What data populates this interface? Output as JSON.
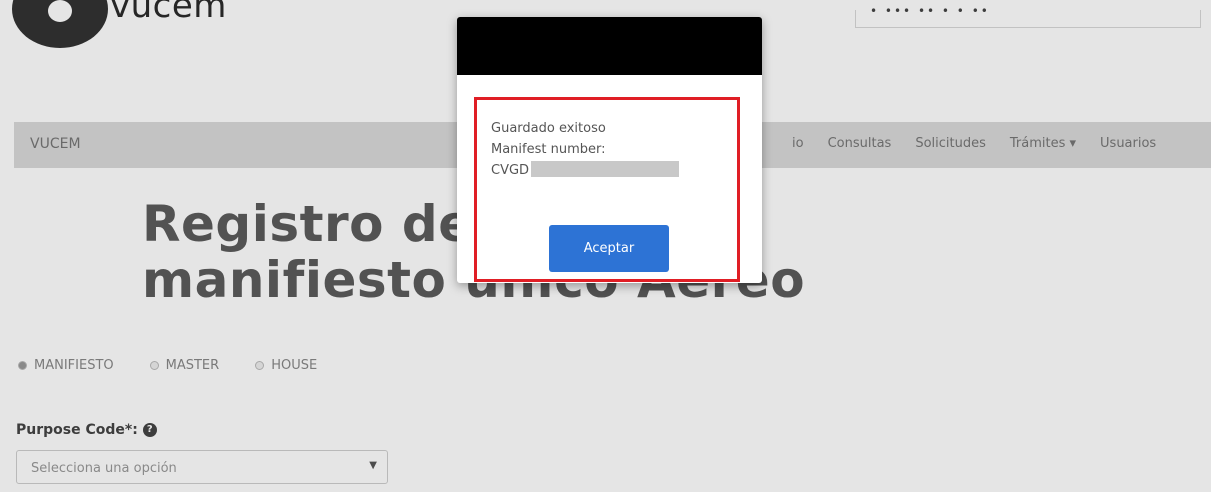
{
  "header": {
    "logo_text": "vucem",
    "top_right_text": "• ••• •• • • ••"
  },
  "navbar": {
    "brand": "VUCEM",
    "items": [
      "io",
      "Consultas",
      "Solicitudes",
      "Trámites ▾",
      "Usuarios"
    ]
  },
  "main": {
    "title_line1": "Registro de",
    "title_line2": "manifiesto único Aéreo",
    "radio_options": [
      {
        "label": "MANIFIESTO",
        "selected": true
      },
      {
        "label": "MASTER",
        "selected": false
      },
      {
        "label": "HOUSE",
        "selected": false
      }
    ],
    "purpose_label": "Purpose Code*:",
    "purpose_placeholder": "Selecciona una opción"
  },
  "modal": {
    "line1": "Guardado exitoso",
    "line2": "Manifest number:",
    "line3_prefix": "CVGD",
    "accept_label": "Aceptar",
    "highlight_color": "#e01e25",
    "button_color": "#2d73d5"
  }
}
